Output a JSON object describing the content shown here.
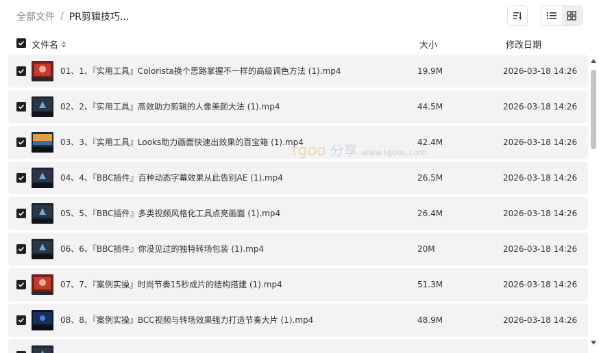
{
  "breadcrumb": {
    "root": "全部文件",
    "separator": "/",
    "current": "PR剪辑技巧..."
  },
  "toolbar": {
    "sort_icon": "sort-icon",
    "list_icon": "list-view-icon",
    "grid_icon": "grid-view-icon"
  },
  "columns": {
    "name": "文件名",
    "size": "大小",
    "date": "修改日期"
  },
  "files": [
    {
      "name": "01、1、『实用工具』Colorista换个思路掌握不一样的高级调色方法 (1).mp4",
      "size": "19.9M",
      "date": "2026-03-18 14:26",
      "thumb": "red"
    },
    {
      "name": "02、2、『实用工具』高效助力剪辑的人像美颜大法 (1).mp4",
      "size": "44.5M",
      "date": "2026-03-18 14:26",
      "thumb": "dark"
    },
    {
      "name": "03、3、『实用工具』Looks助力画面快速出效果的百宝箱 (1).mp4",
      "size": "42.4M",
      "date": "2026-03-18 14:26",
      "thumb": "scene"
    },
    {
      "name": "04、4、『BBC插件』百种动态字幕效果从此告别AE (1).mp4",
      "size": "26.5M",
      "date": "2026-03-18 14:26",
      "thumb": "dark"
    },
    {
      "name": "05、5、『BBC插件』多类视频风格化工具点亮画面 (1).mp4",
      "size": "26.4M",
      "date": "2026-03-18 14:26",
      "thumb": "dark"
    },
    {
      "name": "06、6、『BBC插件』你没见过的独特转场包装 (1).mp4",
      "size": "20M",
      "date": "2026-03-18 14:26",
      "thumb": "dark"
    },
    {
      "name": "07、7、『案例实操』时尚节奏15秒成片的结构搭建 (1).mp4",
      "size": "51.3M",
      "date": "2026-03-18 14:26",
      "thumb": "red"
    },
    {
      "name": "08、8、『案例实操』BCC视频与转场效果强力打造节奏大片 (1).mp4",
      "size": "48.9M",
      "date": "2026-03-18 14:26",
      "thumb": "blue"
    }
  ],
  "watermark": {
    "logo": "tgoo",
    "cn": "分享",
    "url": "www.tgoos.com"
  },
  "colors": {
    "row_bg": "#f3f3f3",
    "checkbox": "#1f1f1f",
    "scroll_thumb": "#c4c4c4"
  }
}
